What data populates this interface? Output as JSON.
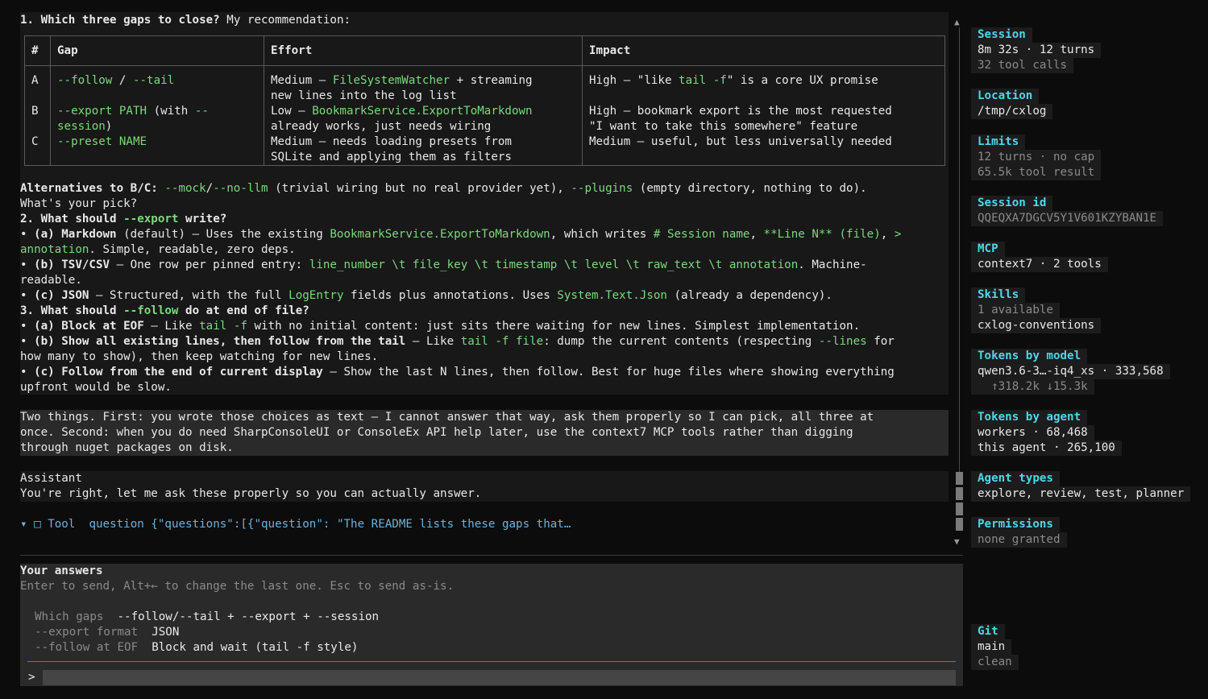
{
  "q1": {
    "heading_num": "1.",
    "heading_bold": "Which three gaps to close?",
    "heading_rest": " My recommendation:"
  },
  "table": {
    "headers": [
      "#",
      "Gap",
      "Effort",
      "Impact"
    ],
    "rows": [
      {
        "id": "A",
        "gap1_g": "--follow",
        "gap1_mid": " / ",
        "gap1_g2": "--tail",
        "effort1_a": "Medium — ",
        "effort1_g": "FileSystemWatcher",
        "effort1_b": " + streaming",
        "effort2": "new lines into the log list",
        "impact1_a": "High — \"like ",
        "impact1_g": "tail -f",
        "impact1_b": "\" is a core UX promise"
      },
      {
        "id": "B",
        "gap1_g": "--export PATH",
        "gap1_mid": " (with ",
        "gap1_g2": "--",
        "gap2_g": "session",
        "gap2_b": ")",
        "effort1_a": "Low — ",
        "effort1_g": "BookmarkService.ExportToMarkdown",
        "effort2": "already works, just needs wiring",
        "impact1": "High — bookmark export is the most requested",
        "impact2": "\"I want to take this somewhere\" feature"
      },
      {
        "id": "C",
        "gap1_g": "--preset NAME",
        "effort1": "Medium — needs loading presets from",
        "effort2": "SQLite and applying them as filters",
        "impact1": "Medium — useful, but less universally needed"
      }
    ]
  },
  "alt": {
    "bold": "Alternatives to B/C:",
    "g1": "--mock",
    "sep": "/",
    "g2": "--no-llm",
    "mid": " (trivial wiring but no real provider yet), ",
    "g3": "--plugins",
    "end": " (empty directory, nothing to do)."
  },
  "pick": "What's your pick?",
  "q2": {
    "num": "2.",
    "b1": "What should ",
    "g": "--export",
    "b2": " write?"
  },
  "q2a": {
    "bullet": "• ",
    "bold": "(a) Markdown",
    "t1": " (default) — Uses the existing ",
    "g1": "BookmarkService.ExportToMarkdown",
    "t2": ", which writes ",
    "g2": "# Session name",
    "t3": ", ",
    "g3": "**Line N** (file)",
    "t4": ", ",
    "g4": ">",
    "g5": "annotation",
    "t5": ". Simple, readable, zero deps."
  },
  "q2b": {
    "bullet": "• ",
    "bold": "(b) TSV/CSV",
    "t1": " — One row per pinned entry: ",
    "g1": "line_number \\t file_key \\t timestamp \\t level \\t raw_text \\t annotation",
    "t2": ". Machine-",
    "t3": "readable."
  },
  "q2c": {
    "bullet": "• ",
    "bold": "(c) JSON",
    "t1": " — Structured, with the full ",
    "g1": "LogEntry",
    "t2": " fields plus annotations. Uses ",
    "g2": "System.Text.Json",
    "t3": " (already a dependency)."
  },
  "q3": {
    "num": "3.",
    "b1": "What should ",
    "g": "--follow",
    "b2": " do at end of file?"
  },
  "q3a": {
    "bullet": "• ",
    "bold": "(a) Block at EOF",
    "t1": " — Like ",
    "g1": "tail -f",
    "t2": " with no initial content: just sits there waiting for new lines. Simplest implementation."
  },
  "q3b": {
    "bullet": "• ",
    "bold": "(b) Show all existing lines, then follow from the tail",
    "t1": " — Like ",
    "g1": "tail -f file",
    "t2": ": dump the current contents (respecting ",
    "g2": "--lines",
    "t3": " for",
    "t4": "how many to show), then keep watching for new lines."
  },
  "q3c": {
    "bullet": "• ",
    "bold": "(c) Follow from the end of current display",
    "t1": " — Show the last N lines, then follow. Best for huge files where showing everything",
    "t2": "upfront would be slow."
  },
  "user_msg": [
    "Two things. First: you wrote those choices as text — I cannot answer that way, ask them properly so I can pick, all three at",
    "once. Second: when you do need SharpConsoleUI or ConsoleEx API help later, use the context7 MCP tools rather than digging",
    "through nuget packages on disk."
  ],
  "assistant": {
    "label": "Assistant",
    "text": "You're right, let me ask these properly so you can actually answer."
  },
  "tool": {
    "chevron": "▾",
    "icon": "□",
    "label": "Tool",
    "name": "question",
    "args": "{\"questions\":[{\"question\": \"The README lists these gaps that…"
  },
  "answers": {
    "title": "Your answers",
    "hint": "Enter to send, Alt+← to change the last one. Esc to send as-is.",
    "rows": [
      {
        "label": "Which gaps",
        "value": "--follow/--tail + --export + --session"
      },
      {
        "label": "--export format",
        "value": "JSON"
      },
      {
        "label": "--follow at EOF",
        "value": "Block and wait (tail -f style)"
      }
    ],
    "prompt": ">"
  },
  "scroll": {
    "up": "▲",
    "down": "▼"
  },
  "sidebar": {
    "session": {
      "h": "Session",
      "v1": "8m 32s · 12 turns",
      "v2": "32 tool calls"
    },
    "location": {
      "h": "Location",
      "v1": "/tmp/cxlog"
    },
    "limits": {
      "h": "Limits",
      "v1": "12 turns · no cap",
      "v2": "65.5k tool result"
    },
    "session_id": {
      "h": "Session id",
      "v1": "QQEQXA7DGCV5Y1V601KZYBAN1E"
    },
    "mcp": {
      "h": "MCP",
      "v1": "context7 · 2 tools"
    },
    "skills": {
      "h": "Skills",
      "v1": "1 available",
      "v2": "cxlog-conventions"
    },
    "tokens_model": {
      "h": "Tokens by model",
      "v1": "qwen3.6-3…-iq4_xs · 333,568",
      "v2": "  ↑318.2k ↓15.3k"
    },
    "tokens_agent": {
      "h": "Tokens by agent",
      "v1": "workers · 68,468",
      "v2": "this agent · 265,100"
    },
    "agent_types": {
      "h": "Agent types",
      "v1": "explore, review, test, planner"
    },
    "permissions": {
      "h": "Permissions",
      "v1": "none granted"
    },
    "git": {
      "h": "Git",
      "v1": "main",
      "v2": "clean"
    }
  },
  "colors": {
    "accent": "#4fd6e8",
    "code": "#7dd87d",
    "tool": "#6fb0d8",
    "prompt_rule": "#5a78a8"
  }
}
